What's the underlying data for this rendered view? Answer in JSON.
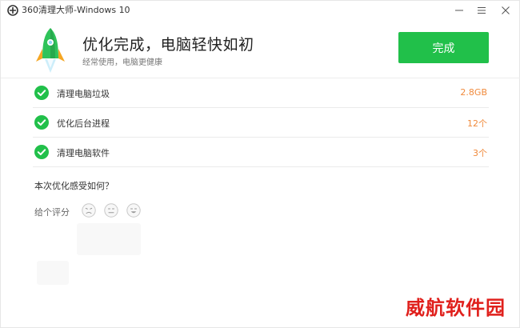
{
  "window": {
    "title": "360清理大师-Windows 10"
  },
  "header": {
    "headline": "优化完成，电脑轻快如初",
    "subline": "经常使用，电脑更健康",
    "done_label": "完成"
  },
  "results": [
    {
      "label": "清理电脑垃圾",
      "value": "2.8GB",
      "icon": "check-circle-icon"
    },
    {
      "label": "优化后台进程",
      "value": "12个",
      "icon": "check-circle-icon"
    },
    {
      "label": "清理电脑软件",
      "value": "3个",
      "icon": "check-circle-icon"
    }
  ],
  "feedback": {
    "question": "本次优化感受如何？",
    "rate_label": "给个评分",
    "faces": [
      "sad-face-icon",
      "neutral-face-icon",
      "happy-face-icon"
    ]
  },
  "watermark": "威航软件园",
  "colors": {
    "accent_green": "#21c04a",
    "value_orange": "#f08a3c",
    "watermark_red": "#e0201c"
  }
}
